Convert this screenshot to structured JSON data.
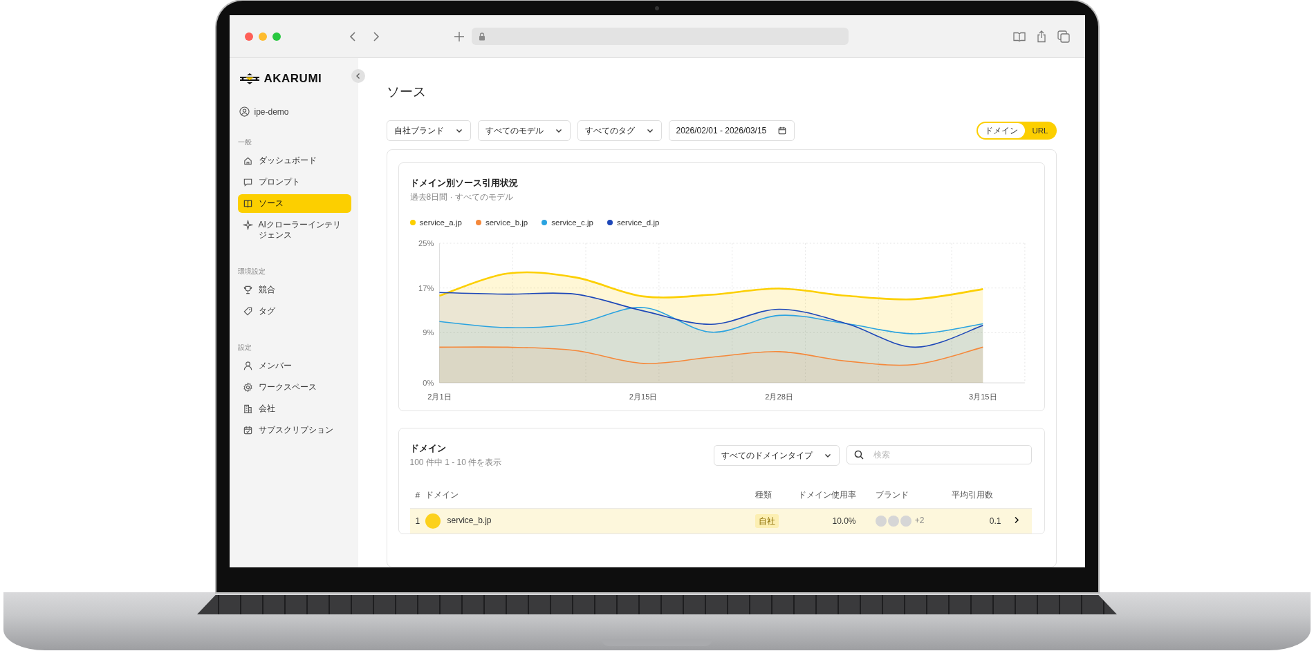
{
  "sidebar": {
    "logo": "AKARUMI",
    "user": "ipe-demo",
    "sections": [
      {
        "title": "一般",
        "items": [
          {
            "label": "ダッシュボード",
            "selected": false
          },
          {
            "label": "プロンプト",
            "selected": false
          },
          {
            "label": "ソース",
            "selected": true
          },
          {
            "label": "AIクローラーインテリジェンス",
            "selected": false
          }
        ]
      },
      {
        "title": "環境設定",
        "items": [
          {
            "label": "競合",
            "selected": false
          },
          {
            "label": "タグ",
            "selected": false
          }
        ]
      },
      {
        "title": "設定",
        "items": [
          {
            "label": "メンバー",
            "selected": false
          },
          {
            "label": "ワークスペース",
            "selected": false
          },
          {
            "label": "会社",
            "selected": false
          },
          {
            "label": "サブスクリプション",
            "selected": false
          }
        ]
      }
    ]
  },
  "page": {
    "title": "ソース",
    "filters": [
      {
        "kind": "dropdown",
        "label": "自社ブランド"
      },
      {
        "kind": "dropdown",
        "label": "すべてのモデル"
      },
      {
        "kind": "dropdown",
        "label": "すべてのタグ"
      },
      {
        "kind": "date",
        "label": "2026/02/01 - 2026/03/15"
      }
    ],
    "view_toggle": [
      {
        "label": "ドメイン",
        "selected": true
      },
      {
        "label": "URL",
        "selected": false
      }
    ]
  },
  "chart_card": {
    "title": "ドメイン別ソース引用状況",
    "subtitle": "過去8日間 · すべてのモデル",
    "chart_data": {
      "type": "area",
      "stacked": false,
      "categories": [
        "2月1日",
        null,
        null,
        "2月15日",
        null,
        "2月28日",
        null,
        null,
        "3月15日"
      ],
      "ylim": [
        0,
        25
      ],
      "yticks": [
        {
          "value": 0,
          "label": "0%"
        },
        {
          "value": 9,
          "label": "9%"
        },
        {
          "value": 17,
          "label": "17%"
        },
        {
          "value": 25,
          "label": "25%"
        }
      ],
      "series": [
        {
          "name": "service_a.jp",
          "color": "#fccf00",
          "values": [
            15.6,
            19.6,
            18.9,
            15.5,
            15.8,
            16.9,
            15.6,
            15.0,
            16.8
          ]
        },
        {
          "name": "service_b.jp",
          "color": "#f5883a",
          "values": [
            6.4,
            6.4,
            5.8,
            3.5,
            4.6,
            5.6,
            3.9,
            3.3,
            6.4
          ]
        },
        {
          "name": "service_c.jp",
          "color": "#2aa3e0",
          "values": [
            11.0,
            9.9,
            10.6,
            13.5,
            9.1,
            12.1,
            10.6,
            8.8,
            10.6
          ]
        },
        {
          "name": "service_d.jp",
          "color": "#1d47b8",
          "values": [
            16.2,
            15.9,
            15.9,
            12.9,
            10.5,
            13.2,
            10.6,
            6.4,
            10.3
          ]
        }
      ]
    }
  },
  "domains": {
    "title": "ドメイン",
    "count": "100 件中 1 - 10 件を表示",
    "type_filter": "すべてのドメインタイプ",
    "search": {
      "placeholder": "検索"
    },
    "columns": [
      "#",
      "ドメイン",
      "種類",
      "ドメイン使用率",
      "ブランド",
      "平均引用数"
    ],
    "rows": [
      {
        "rank": "1",
        "domain": "service_b.jp",
        "type": "自社",
        "usage": "10.0%",
        "brands_more": "+2",
        "avg_citations": "0.1",
        "selected": true
      }
    ]
  }
}
